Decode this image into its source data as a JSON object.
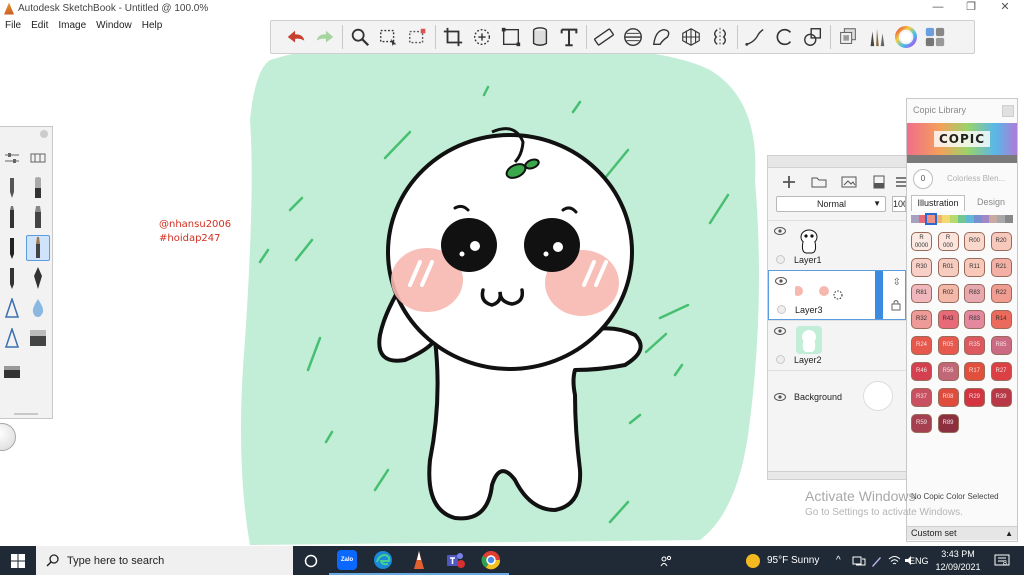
{
  "window": {
    "title": "Autodesk SketchBook - Untitled @ 100.0%",
    "minimize_glyph": "—",
    "restore_glyph": "❐",
    "close_glyph": "✕"
  },
  "menu": [
    "File",
    "Edit",
    "Image",
    "Window",
    "Help"
  ],
  "toolbar": {
    "tools": [
      "undo-icon",
      "redo-icon",
      "zoom-icon",
      "select-icon",
      "select-content-icon",
      "crop-icon",
      "transform-icon",
      "distort-icon",
      "fill-icon",
      "text-icon",
      "ruler-icon",
      "ellipse-guide-icon",
      "french-curve-icon",
      "perspective-icon",
      "symmetry-icon",
      "stroke-icon",
      "shape-icon",
      "shapes-icon",
      "layers-icon",
      "brushes-icon",
      "color-wheel-icon",
      "copic-icon"
    ]
  },
  "canvas": {
    "watermark_line1": "@nhansu2006",
    "watermark_line2": "#hoidap247",
    "background_color": "#c2edd6",
    "accent_color": "#d03020"
  },
  "layers": {
    "blend_mode": "Normal",
    "opacity": "100",
    "items": [
      {
        "name": "Layer1",
        "active": false
      },
      {
        "name": "Layer3",
        "active": true
      },
      {
        "name": "Layer2",
        "active": false
      },
      {
        "name": "Background",
        "active": false
      }
    ]
  },
  "copic": {
    "title": "Copic Library",
    "logo": "COPIC",
    "colorless_value": "0",
    "colorless_label": "Colorless Blen...",
    "tab_illustration": "Illustration",
    "tab_design": "Design",
    "swatches": [
      {
        "code": "R\n0000",
        "color": "#fbeae4"
      },
      {
        "code": "R\n000",
        "color": "#fbe4dc"
      },
      {
        "code": "R00",
        "color": "#f9d8cc"
      },
      {
        "code": "R20",
        "color": "#f7c8bc"
      },
      {
        "code": "R30",
        "color": "#f8d0c8"
      },
      {
        "code": "R01",
        "color": "#f6ccc0"
      },
      {
        "code": "R11",
        "color": "#f8c8b8"
      },
      {
        "code": "R21",
        "color": "#f4b0a4"
      },
      {
        "code": "R81",
        "color": "#f0b8bc"
      },
      {
        "code": "R02",
        "color": "#f4b8a8"
      },
      {
        "code": "R83",
        "color": "#e8a8b0"
      },
      {
        "code": "R22",
        "color": "#f09c90"
      },
      {
        "code": "R32",
        "color": "#ee9a98"
      },
      {
        "code": "R43",
        "color": "#e86a78"
      },
      {
        "code": "R83",
        "color": "#e488a0"
      },
      {
        "code": "R14",
        "color": "#ec6a5c"
      },
      {
        "code": "R24",
        "color": "#e6584c"
      },
      {
        "code": "R05",
        "color": "#e8584c"
      },
      {
        "code": "R35",
        "color": "#de5860"
      },
      {
        "code": "R85",
        "color": "#cc6a84"
      },
      {
        "code": "R46",
        "color": "#d44050"
      },
      {
        "code": "R56",
        "color": "#c06878"
      },
      {
        "code": "R17",
        "color": "#e0503c"
      },
      {
        "code": "R27",
        "color": "#dc4044"
      },
      {
        "code": "R37",
        "color": "#c85060"
      },
      {
        "code": "R08",
        "color": "#e04c3c"
      },
      {
        "code": "R29",
        "color": "#d43440"
      },
      {
        "code": "R39",
        "color": "#b83848"
      },
      {
        "code": "R59",
        "color": "#a44050"
      },
      {
        "code": "R89",
        "color": "#8c3040"
      }
    ],
    "status": "No Copic Color Selected",
    "custom_set": "Custom set"
  },
  "activation": {
    "line1": "Activate Windows",
    "line2": "Go to Settings to activate Windows."
  },
  "taskbar": {
    "search_placeholder": "Type here to search",
    "weather": "95°F  Sunny",
    "language": "ENG",
    "time": "3:43 PM",
    "date": "12/09/2021",
    "zalo_label": "Zalo",
    "notification_count": "8"
  }
}
